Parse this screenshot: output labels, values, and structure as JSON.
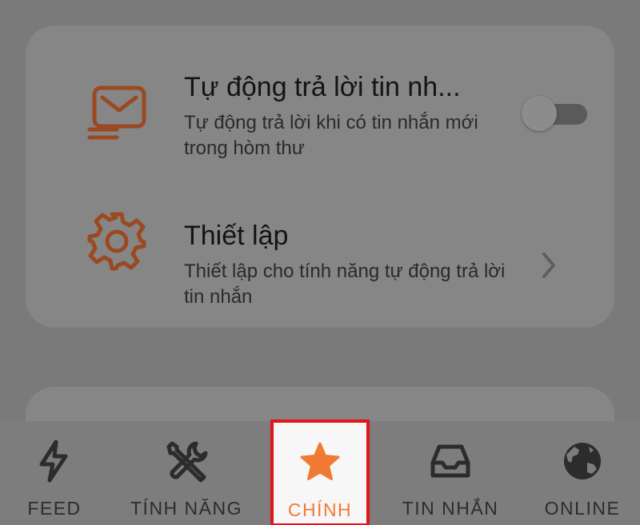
{
  "card": {
    "auto_reply": {
      "title": "Tự động trả lời tin nh...",
      "subtitle": "Tự động trả lời khi có tin nhắn mới trong hòm thư",
      "icon": "mail-icon",
      "toggle_on": false
    },
    "settings": {
      "title": "Thiết lập",
      "subtitle": "Thiết lập cho tính năng tự động trả lời tin nhắn",
      "icon": "gear-icon"
    }
  },
  "nav": {
    "items": [
      {
        "label": "FEED",
        "icon": "lightning-icon"
      },
      {
        "label": "TÍNH NĂNG",
        "icon": "tools-icon"
      },
      {
        "label": "CHÍNH",
        "icon": "star-icon",
        "active": true
      },
      {
        "label": "TIN NHẮN",
        "icon": "inbox-icon"
      },
      {
        "label": "ONLINE",
        "icon": "globe-icon"
      }
    ]
  },
  "colors": {
    "accent": "#f07a34",
    "icon_brown": "#9a4a22",
    "highlight_border": "#e3151a"
  }
}
